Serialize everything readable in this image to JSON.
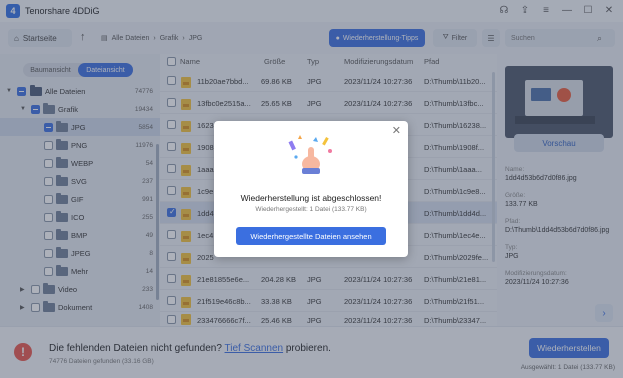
{
  "app": {
    "title": "Tenorshare 4DDiG",
    "logo_letter": "4"
  },
  "titlebar": {
    "icons": [
      "headset-icon",
      "upload-icon",
      "menu-icon",
      "minimize-icon",
      "maximize-icon",
      "close-icon"
    ]
  },
  "toolbar": {
    "home_label": "Startseite",
    "breadcrumb": [
      "Alle Dateien",
      "Grafik",
      "JPG"
    ],
    "tips_label": "Wiederherstellung-Tipps",
    "filter_label": "Filter",
    "search_placeholder": "Suchen"
  },
  "sidebar": {
    "tabs": [
      "Baumansicht",
      "Dateiansicht"
    ],
    "active_tab": "Dateiansicht",
    "tree": [
      {
        "label": "Alle Dateien",
        "count": "74776"
      },
      {
        "label": "Grafik",
        "count": "19434"
      },
      {
        "label": "JPG",
        "count": "5854"
      },
      {
        "label": "PNG",
        "count": "11976"
      },
      {
        "label": "WEBP",
        "count": "54"
      },
      {
        "label": "SVG",
        "count": "237"
      },
      {
        "label": "GIF",
        "count": "991"
      },
      {
        "label": "ICO",
        "count": "255"
      },
      {
        "label": "BMP",
        "count": "49"
      },
      {
        "label": "JPEG",
        "count": "8"
      },
      {
        "label": "Mehr",
        "count": "14"
      },
      {
        "label": "Video",
        "count": "233"
      },
      {
        "label": "Dokument",
        "count": "1408"
      }
    ]
  },
  "list": {
    "columns": {
      "name": "Name",
      "size": "Größe",
      "type": "Typ",
      "modified": "Modifizierungsdatum",
      "path": "Pfad"
    },
    "rows": [
      {
        "name": "11b20ae7bbd...",
        "size": "69.86 KB",
        "type": "JPG",
        "modified": "2023/11/24 10:27:36",
        "path": "D:\\Thumb\\11b20..."
      },
      {
        "name": "13fbc0e2515a...",
        "size": "25.65 KB",
        "type": "JPG",
        "modified": "2023/11/24 10:27:36",
        "path": "D:\\Thumb\\13fbc..."
      },
      {
        "name": "1623",
        "size": "",
        "type": "",
        "modified": "",
        "path": "D:\\Thumb\\16238..."
      },
      {
        "name": "1908",
        "size": "",
        "type": "",
        "modified": "",
        "path": "D:\\Thumb\\1908f..."
      },
      {
        "name": "1aaa",
        "size": "",
        "type": "",
        "modified": "",
        "path": "D:\\Thumb\\1aaa..."
      },
      {
        "name": "1c9e",
        "size": "",
        "type": "",
        "modified": "",
        "path": "D:\\Thumb\\1c9e8..."
      },
      {
        "name": "1dd4",
        "size": "",
        "type": "",
        "modified": "",
        "path": "D:\\Thumb\\1dd4d..."
      },
      {
        "name": "1ec4",
        "size": "",
        "type": "",
        "modified": "",
        "path": "D:\\Thumb\\1ec4e..."
      },
      {
        "name": "2025",
        "size": "",
        "type": "",
        "modified": "",
        "path": "D:\\Thumb\\2029fe..."
      },
      {
        "name": "21e81855e6e...",
        "size": "204.28 KB",
        "type": "JPG",
        "modified": "2023/11/24 10:27:36",
        "path": "D:\\Thumb\\21e81..."
      },
      {
        "name": "21f519e46c8b...",
        "size": "33.38 KB",
        "type": "JPG",
        "modified": "2023/11/24 10:27:36",
        "path": "D:\\Thumb\\21f51..."
      },
      {
        "name": "233476666c7f...",
        "size": "25.46 KB",
        "type": "JPG",
        "modified": "2023/11/24 10:27:36",
        "path": "D:\\Thumb\\23347..."
      }
    ]
  },
  "detail": {
    "preview_label": "Vorschau",
    "fields": [
      {
        "key": "Name:",
        "value": "1dd4d53b6d7d0f86.jpg"
      },
      {
        "key": "Größe:",
        "value": "133.77 KB"
      },
      {
        "key": "Pfad:",
        "value": "D:\\Thumb\\1dd4d53b6d7d0f86.jpg"
      },
      {
        "key": "Typ:",
        "value": "JPG"
      },
      {
        "key": "Modifizierungsdatum:",
        "value": "2023/11/24 10:27:36"
      }
    ]
  },
  "bottom": {
    "message_prefix": "Die fehlenden Dateien nicht gefunden?",
    "link": "Tief Scannen",
    "message_suffix": "probieren.",
    "sub": "74776 Dateien gefunden (33.16 GB)",
    "recover_label": "Wiederherstellen",
    "selected_info": "Ausgewählt: 1 Datei (133.77 KB)"
  },
  "modal": {
    "title": "Wiederherstellung ist abgeschlossen!",
    "subtitle": "Wiederhergestellt: 1 Datei (133.77 KB)",
    "button": "Wiederhergestellte Dateien ansehen"
  }
}
